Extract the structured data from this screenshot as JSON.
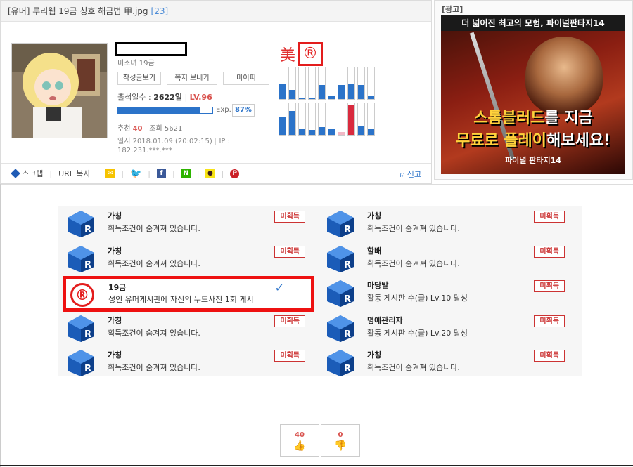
{
  "post": {
    "title": "[유머] 루리웹 19금 칭호 해금법 甲.jpg",
    "comment_count": "[23]",
    "grade": "미소녀 19금",
    "buttons": [
      "작성글보기",
      "쪽지 보내기",
      "마이피"
    ],
    "attendance_label": "출석일수 :",
    "attendance_value": "2622일",
    "level": "LV.96",
    "exp_label": "Exp.",
    "exp_percent": "87%",
    "exp_fraction": 0.87,
    "rec_label": "추천",
    "rec_value": "40",
    "views_label": "조회",
    "views_value": "5621",
    "date_text": "일시 2018.01.09 (20:02:15)",
    "ip_text": "IP : 182.231.***.***"
  },
  "title_mark": {
    "prefix": "美",
    "symbol": "®"
  },
  "activity_bars": {
    "row1": [
      0.5,
      0.3,
      0.05,
      0.05,
      0.45,
      0.1,
      0.45,
      0.5,
      0.45,
      0.1
    ],
    "row2": [
      0.55,
      0.75,
      0.2,
      0.15,
      0.25,
      0.2,
      0.1,
      0.95,
      0.3,
      0.2
    ],
    "row2_colors": [
      "#2b73c9",
      "#2b73c9",
      "#2b73c9",
      "#2b73c9",
      "#2b73c9",
      "#2b73c9",
      "#f2b8c6",
      "#d92a3e",
      "#2b73c9",
      "#2b73c9"
    ]
  },
  "share": {
    "scrap": "스크랩",
    "url_copy": "URL 복사",
    "report": "신고"
  },
  "ad": {
    "label": "[광고]",
    "headline": "더 넓어진 최고의 모험, 파이널판타지14",
    "line1_a": "스톰블러드",
    "line1_b": "를 지금",
    "line2_a": "무료로 플레이",
    "line2_b": "해보세요!",
    "brand": "파이널 판타지14"
  },
  "achievements": {
    "left": [
      {
        "name": "가칭",
        "desc": "획득조건이 숨겨져 있습니다.",
        "badge": "미획득"
      },
      {
        "name": "가칭",
        "desc": "획득조건이 숨겨져 있습니다.",
        "badge": "미획득"
      },
      {
        "name": "19금",
        "desc": "성인 유머게시판에 자신의 누드사진 1회 게시",
        "badge": ""
      },
      {
        "name": "가칭",
        "desc": "획득조건이 숨겨져 있습니다.",
        "badge": "미획득"
      },
      {
        "name": "가칭",
        "desc": "획득조건이 숨겨져 있습니다.",
        "badge": "미획득"
      }
    ],
    "right": [
      {
        "name": "가칭",
        "desc": "획득조건이 숨겨져 있습니다.",
        "badge": "미획득"
      },
      {
        "name": "할배",
        "desc": "획득조건이 숨겨져 있습니다.",
        "badge": "미획득"
      },
      {
        "name": "마당발",
        "desc": "활동 게시판 수(글) Lv.10 달성",
        "badge": "미획득"
      },
      {
        "name": "명예관리자",
        "desc": "활동 게시판 수(글) Lv.20 달성",
        "badge": "미획득"
      },
      {
        "name": "가칭",
        "desc": "획득조건이 숨겨져 있습니다.",
        "badge": "미획득"
      }
    ]
  },
  "votes": {
    "up": "40",
    "down": "0"
  },
  "colors": {
    "accent": "#2b73c9",
    "highlight": "#ee1111",
    "badge": "#cc3333"
  }
}
